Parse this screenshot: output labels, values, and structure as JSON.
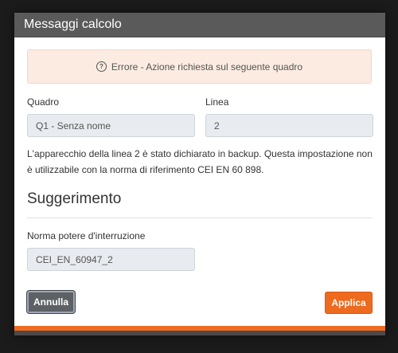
{
  "dialog": {
    "title": "Messaggi calcolo",
    "alert": {
      "icon": "question-circle-icon",
      "text": "Errore - Azione richiesta sul seguente quadro"
    },
    "quadro": {
      "label": "Quadro",
      "value": "Q1 - Senza nome"
    },
    "linea": {
      "label": "Linea",
      "value": "2"
    },
    "message": "L'apparecchio della linea 2 è stato dichiarato in backup. Questa impostazione non è utilizzabile con la norma di riferimento CEI EN 60 898.",
    "suggestion": {
      "title": "Suggerimento",
      "field_label": "Norma potere d'interruzione",
      "field_value": "CEI_EN_60947_2"
    },
    "buttons": {
      "cancel": "Annulla",
      "apply": "Applica"
    },
    "colors": {
      "accent": "#ee6c1f",
      "header": "#5a5a5a",
      "alert_bg": "#fbebe1"
    }
  }
}
